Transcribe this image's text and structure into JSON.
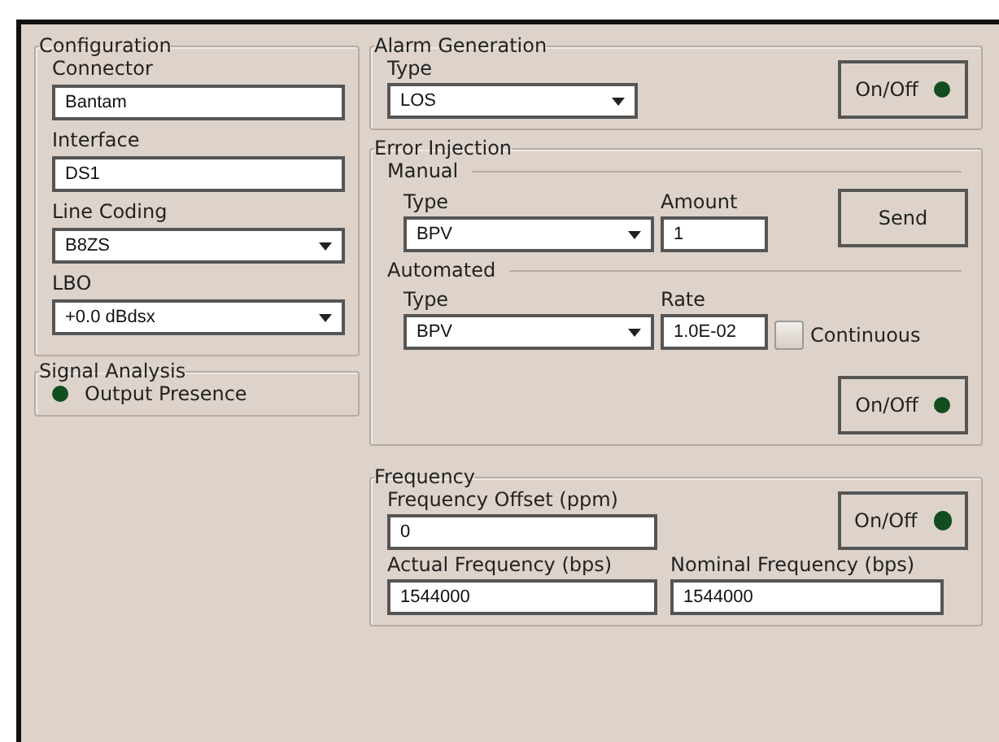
{
  "configuration": {
    "title": "Configuration",
    "fields": [
      {
        "label": "Connector",
        "kind": "text",
        "value": "Bantam"
      },
      {
        "label": "Interface",
        "kind": "text",
        "value": "DS1"
      },
      {
        "label": "Line Coding",
        "kind": "dropdown",
        "value": "B8ZS"
      },
      {
        "label": "LBO",
        "kind": "dropdown",
        "value": "+0.0 dBdsx"
      }
    ]
  },
  "signal_analysis": {
    "title": "Signal Analysis",
    "indicator": "Output Presence"
  },
  "alarm_generation": {
    "title": "Alarm Generation",
    "type_label": "Type",
    "type_value": "LOS",
    "button": "On/Off"
  },
  "error_injection": {
    "title": "Error Injection",
    "manual": {
      "title": "Manual",
      "type_label": "Type",
      "type_value": "BPV",
      "amount_label": "Amount",
      "amount_value": "1",
      "button": "Send"
    },
    "automated": {
      "title": "Automated",
      "type_label": "Type",
      "type_value": "BPV",
      "rate_label": "Rate",
      "rate_value": "1.0E-02",
      "continuous": {
        "label": "Continuous",
        "checked": false
      },
      "button": "On/Off"
    }
  },
  "frequency": {
    "title": "Frequency",
    "offset_label": "Frequency Offset (ppm)",
    "offset_value": "0",
    "button": "On/Off",
    "actual_label": "Actual Frequency (bps)",
    "actual_value": "1544000",
    "nominal_label": "Nominal Frequency (bps)",
    "nominal_value": "1544000"
  }
}
